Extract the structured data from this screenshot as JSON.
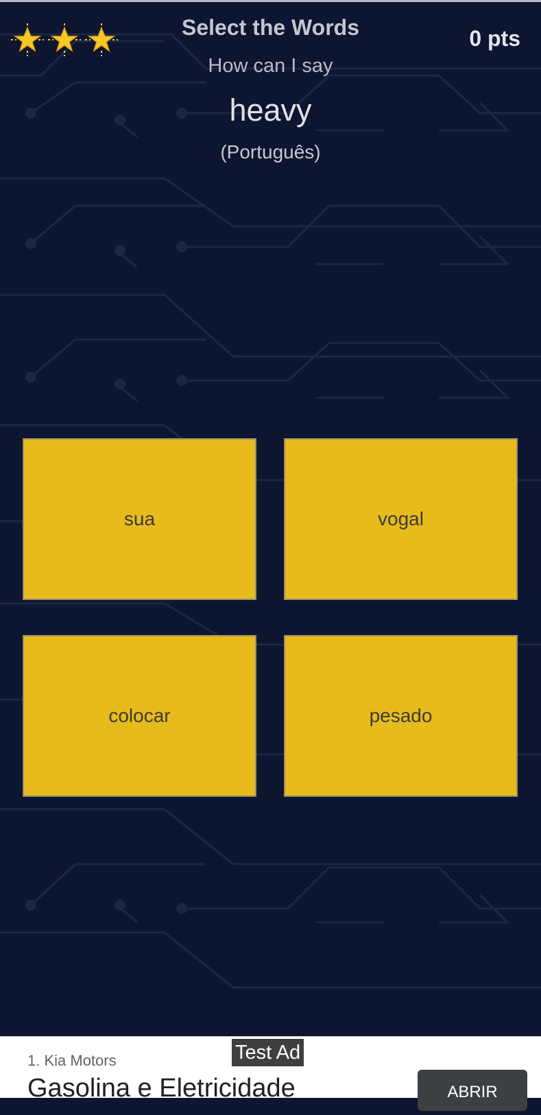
{
  "header": {
    "title": "Select the Words",
    "score": "0 pts",
    "stars": [
      "star-icon",
      "star-icon",
      "star-icon"
    ]
  },
  "question": {
    "prompt": "How can I say",
    "word": "heavy",
    "language": "(Português)"
  },
  "options": [
    "sua",
    "vogal",
    "colocar",
    "pesado"
  ],
  "ad": {
    "badge": "Test Ad",
    "sponsor": "1. Kia Motors",
    "headline": "Gasolina e Eletricidade",
    "button": "ABRIR"
  },
  "colors": {
    "background": "#0e1530",
    "option": "#e8bb1c",
    "circuit": "#1c2746"
  }
}
